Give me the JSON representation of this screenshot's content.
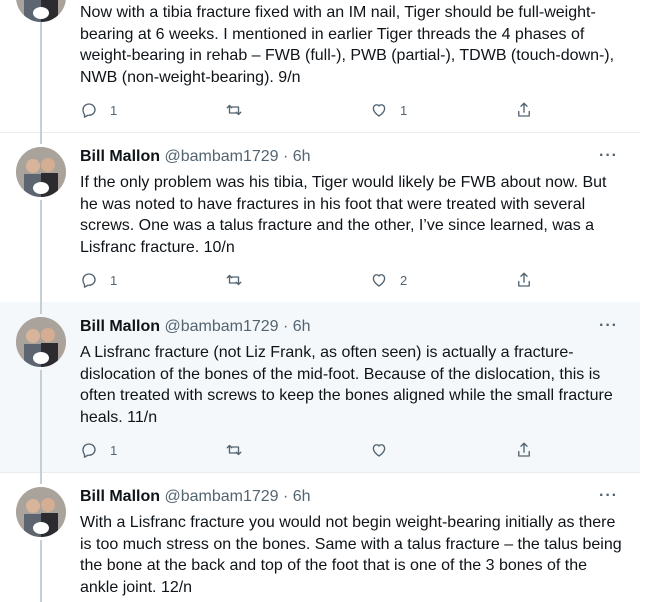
{
  "tweets": [
    {
      "name": "",
      "handle": "",
      "time": "",
      "text": "Now with a tibia fracture fixed with an IM nail, Tiger should be full-weight-bearing at 6 weeks. I mentioned in earlier Tiger threads the 4 phases of weight-bearing in rehab – FWB (full-), PWB (partial-), TDWB (touch-down-), NWB (non-weight-bearing). 9/n",
      "replies": "1",
      "retweets": "",
      "likes": "1"
    },
    {
      "name": "Bill Mallon",
      "handle": "@bambam1729",
      "time": "· 6h",
      "text": "If the only problem was his tibia, Tiger would likely be FWB about now. But he was noted to have fractures in his foot that were treated with several screws. One was a talus fracture and the other, I’ve since learned, was a Lisfranc fracture. 10/n",
      "replies": "1",
      "retweets": "",
      "likes": "2"
    },
    {
      "name": "Bill Mallon",
      "handle": "@bambam1729",
      "time": "· 6h",
      "text": "A Lisfranc fracture (not Liz Frank, as often seen) is actually a fracture-dislocation of the bones of the mid-foot. Because of the dislocation, this is often treated with screws to keep the bones aligned while the small fracture heals. 11/n",
      "replies": "1",
      "retweets": "",
      "likes": ""
    },
    {
      "name": "Bill Mallon",
      "handle": "@bambam1729",
      "time": "· 6h",
      "text": "With a Lisfranc fracture you would not begin weight-bearing initially as there is too much stress on the bones. Same with a talus fracture – the talus being the bone at the back and top of the foot that is one of the 3 bones of the ankle joint. 12/n",
      "replies": "",
      "retweets": "",
      "likes": ""
    }
  ],
  "more_label": "···",
  "icons": {
    "reply": "reply-icon",
    "retweet": "retweet-icon",
    "like": "heart-icon",
    "share": "share-icon",
    "more": "more-icon"
  },
  "colors": {
    "text": "#0f1419",
    "secondary": "#536471",
    "shaded_background": "#f5f8fa",
    "thread_line": "#c4cfd6"
  }
}
